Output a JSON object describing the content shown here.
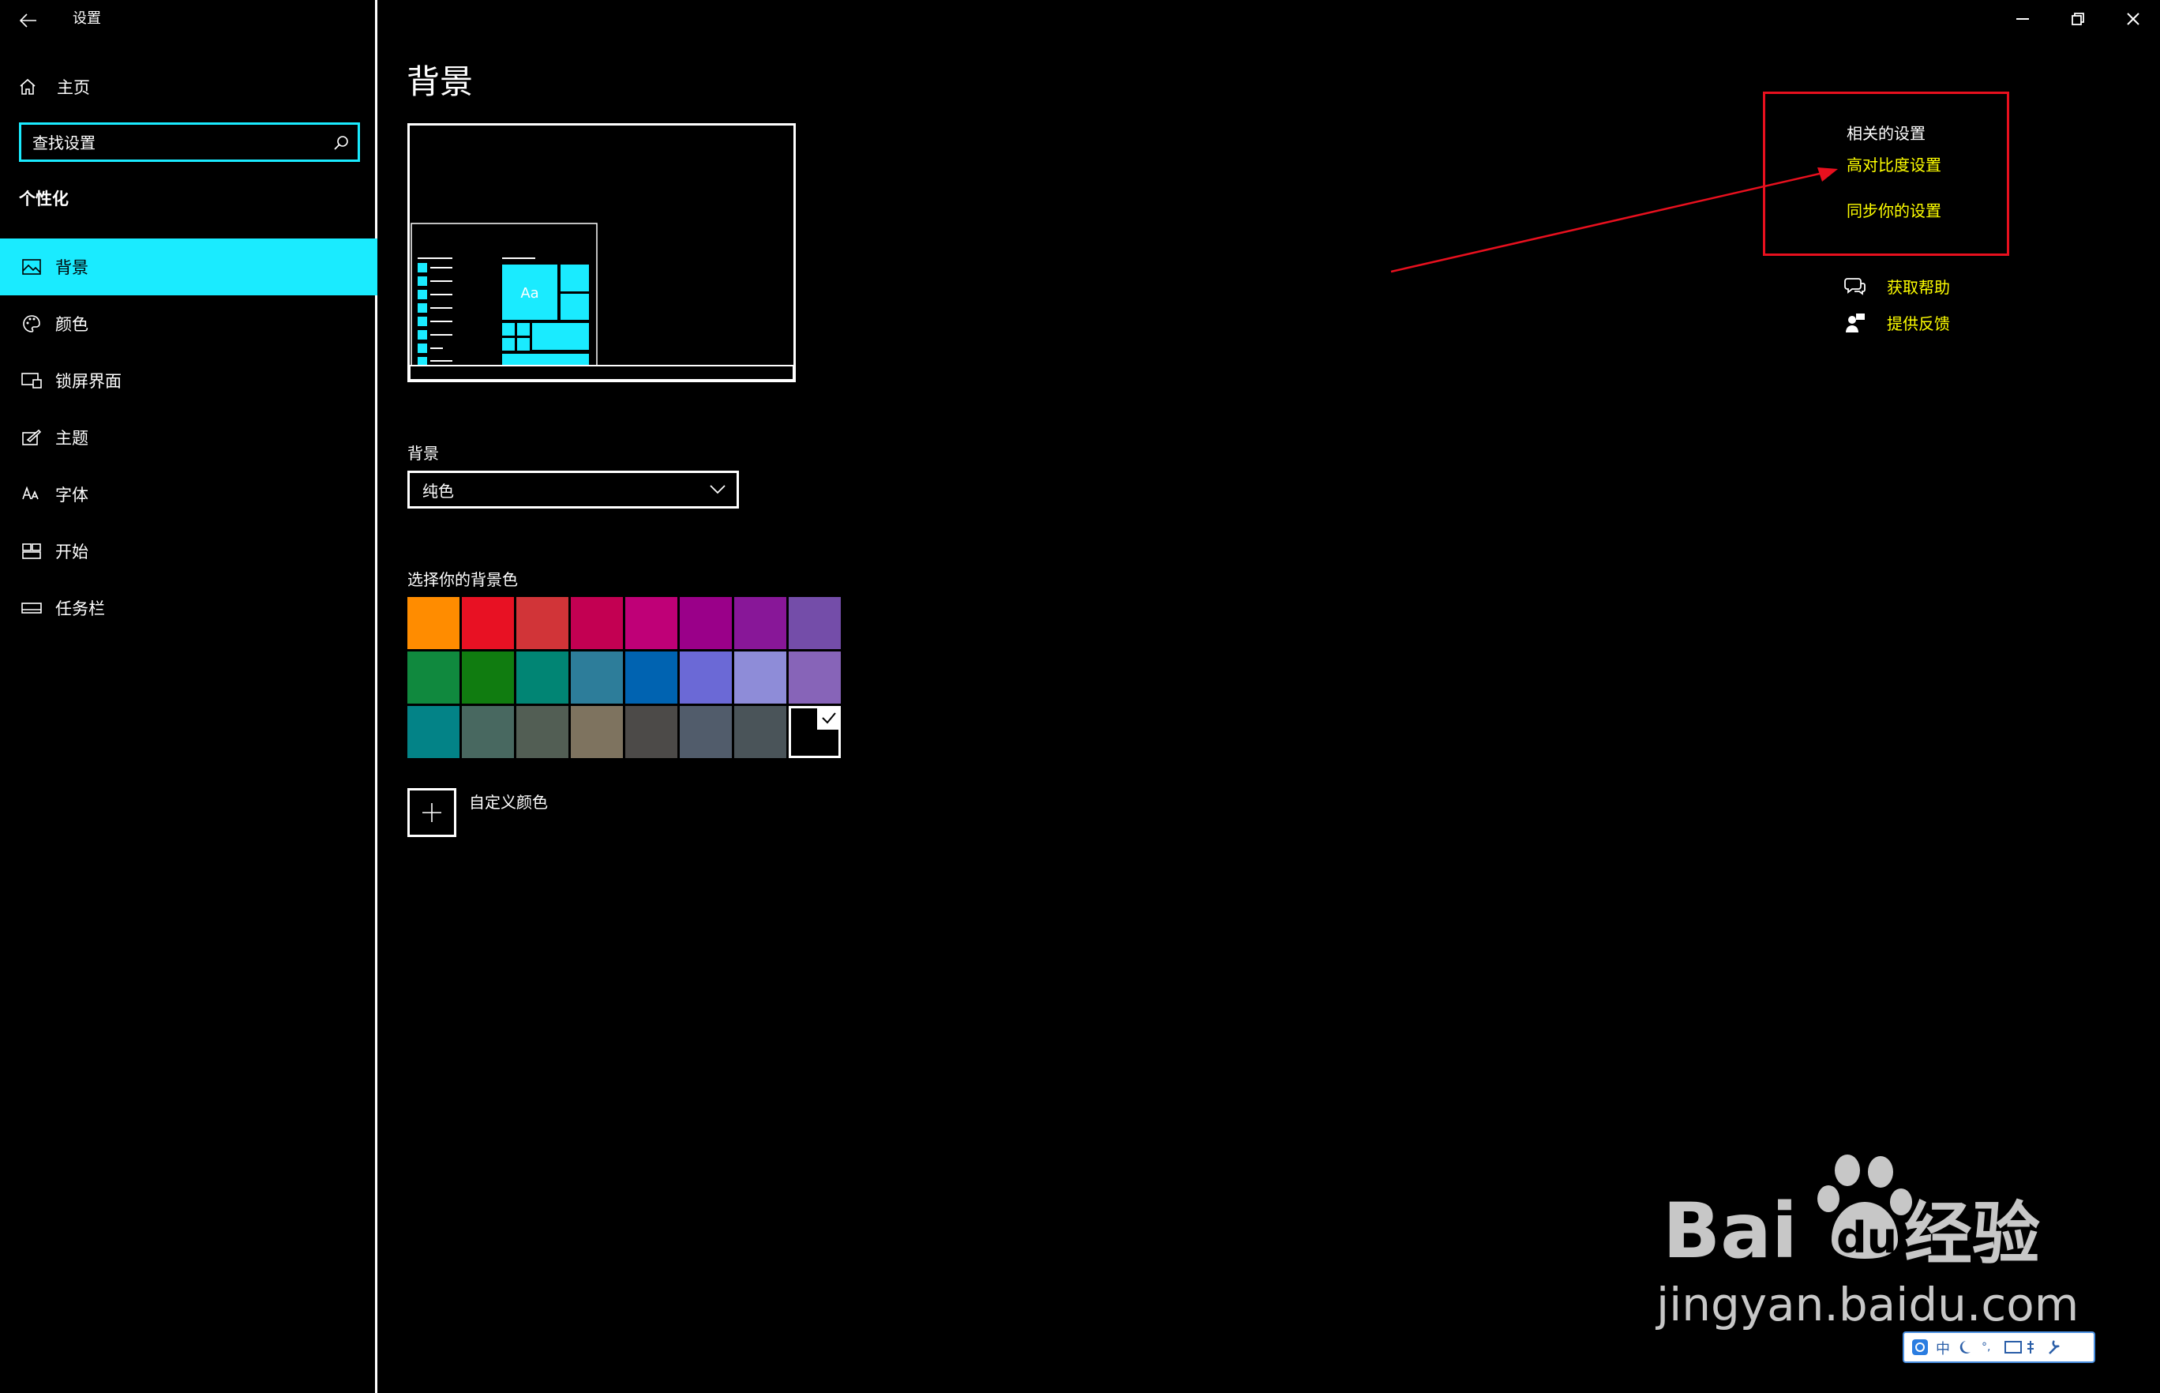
{
  "app": {
    "title": "设置"
  },
  "sidebar": {
    "home_label": "主页",
    "search_placeholder": "查找设置",
    "section_title": "个性化",
    "items": [
      {
        "label": "背景",
        "icon": "picture-icon",
        "active": true
      },
      {
        "label": "颜色",
        "icon": "palette-icon",
        "active": false
      },
      {
        "label": "锁屏界面",
        "icon": "lockscreen-icon",
        "active": false
      },
      {
        "label": "主题",
        "icon": "theme-brush-icon",
        "active": false
      },
      {
        "label": "字体",
        "icon": "font-icon",
        "active": false
      },
      {
        "label": "开始",
        "icon": "start-menu-icon",
        "active": false
      },
      {
        "label": "任务栏",
        "icon": "taskbar-icon",
        "active": false
      }
    ]
  },
  "main": {
    "title": "背景",
    "preview_tile_text": "Aa",
    "background_label": "背景",
    "background_value": "纯色",
    "color_label": "选择你的背景色",
    "colors": [
      "#ff8c00",
      "#e81123",
      "#d13438",
      "#c30052",
      "#bf0077",
      "#9a0089",
      "#881798",
      "#744da9",
      "#10893e",
      "#107c10",
      "#018574",
      "#2d7d9a",
      "#0063b1",
      "#6b69d6",
      "#8e8cd8",
      "#8764b8",
      "#038387",
      "#486860",
      "#525e54",
      "#7e735f",
      "#4c4a48",
      "#515c6b",
      "#4a5459",
      "#000000"
    ],
    "selected_color": "#000000",
    "custom_color_label": "自定义颜色"
  },
  "related": {
    "title": "相关的设置",
    "links": [
      "高对比度设置",
      "同步你的设置"
    ],
    "help_label": "获取帮助",
    "feedback_label": "提供反馈"
  },
  "theme": {
    "accent": "#1aebff",
    "link": "#ffff00",
    "annotation": "#e8101e"
  },
  "watermark": {
    "brand": "Bai",
    "brand2": "du",
    "brand_cn": "经验",
    "url": "jingyan.baidu.com"
  },
  "ime": {
    "lang": "中",
    "punct": "°,"
  }
}
